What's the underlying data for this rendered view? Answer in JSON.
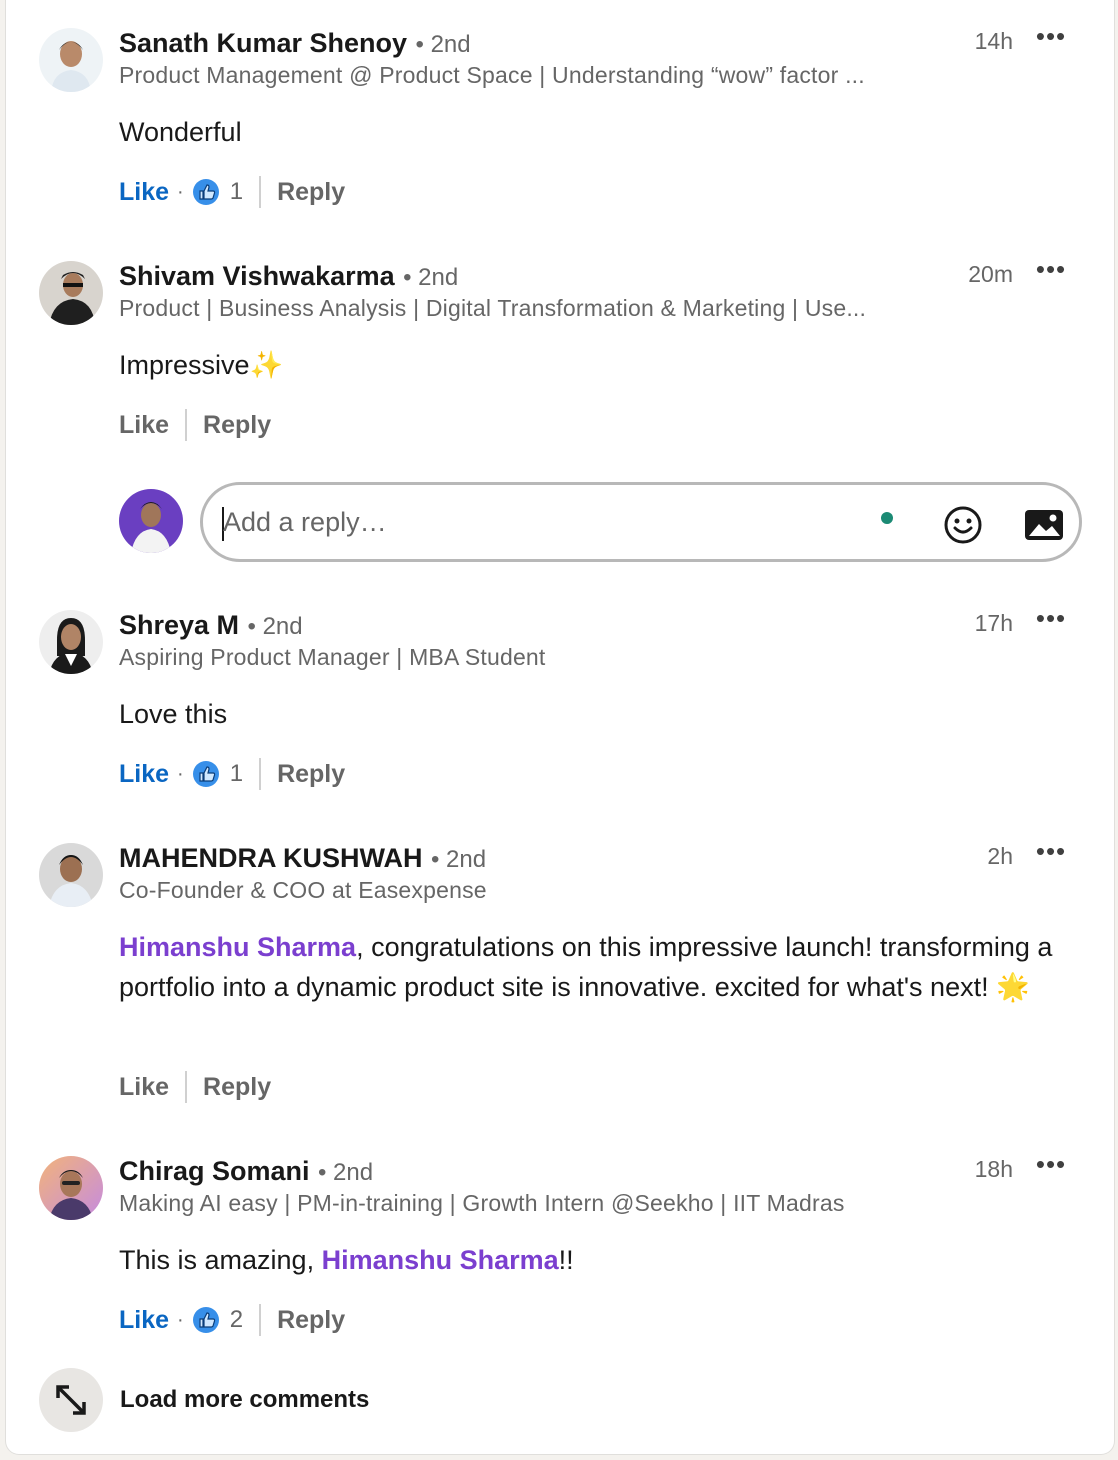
{
  "comments": [
    {
      "name": "Sanath Kumar Shenoy",
      "degree": "• 2nd",
      "headline": "Product Management @ Product Space | Understanding “wow” factor ...",
      "time": "14h",
      "body": "Wonderful",
      "like_label": "Like",
      "like_active": true,
      "reaction_count": "1",
      "reply_label": "Reply"
    },
    {
      "name": "Shivam Vishwakarma",
      "degree": "• 2nd",
      "headline": "Product | Business Analysis | Digital Transformation & Marketing | Use...",
      "time": "20m",
      "body": "Impressive",
      "body_emoji": "✨",
      "like_label": "Like",
      "like_active": false,
      "reply_label": "Reply"
    },
    {
      "name": "Shreya M",
      "degree": "• 2nd",
      "headline": "Aspiring Product Manager | MBA Student",
      "time": "17h",
      "body": "Love this",
      "like_label": "Like",
      "like_active": true,
      "reaction_count": "1",
      "reply_label": "Reply"
    },
    {
      "name": "MAHENDRA KUSHWAH",
      "degree": "• 2nd",
      "headline": "Co-Founder & COO at Easexpense",
      "time": "2h",
      "mention": "Himanshu Sharma",
      "body": ", congratulations on this impressive launch! transforming a portfolio into a dynamic product site is innovative. excited for what's next! ",
      "body_emoji": "🌟",
      "like_label": "Like",
      "like_active": false,
      "reply_label": "Reply"
    },
    {
      "name": "Chirag Somani",
      "degree": "• 2nd",
      "headline": "Making AI easy | PM-in-training | Growth Intern @Seekho | IIT Madras",
      "time": "18h",
      "body_prefix": "This is amazing, ",
      "mention": "Himanshu Sharma",
      "body_suffix": "!!",
      "like_label": "Like",
      "like_active": true,
      "reaction_count": "2",
      "reply_label": "Reply"
    }
  ],
  "reply_box": {
    "placeholder": "Add a reply…",
    "emoji_icon": "smiley-icon",
    "image_icon": "image-icon"
  },
  "load_more": {
    "label": "Load more comments",
    "icon": "expand-arrows-icon"
  },
  "more_menu_glyph": "•••",
  "colors": {
    "like_active": "#0a66c2",
    "mention": "#7b3fcf",
    "secondary_text": "#666666",
    "presence_dot": "#1b8a74"
  }
}
